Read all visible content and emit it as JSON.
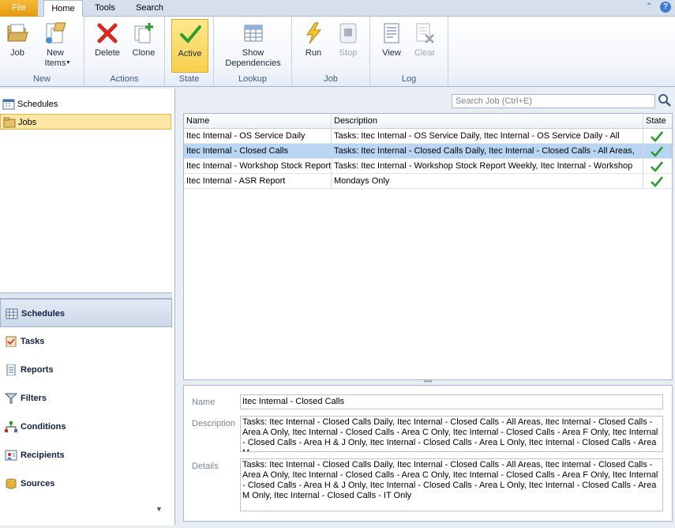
{
  "ribbon_tabs": {
    "file": "File",
    "home": "Home",
    "tools": "Tools",
    "search": "Search"
  },
  "window_controls": {
    "collapse": "⌃",
    "help": "?"
  },
  "ribbon": {
    "groups": {
      "new": "New",
      "actions": "Actions",
      "state": "State",
      "lookup": "Lookup",
      "job": "Job",
      "log": "Log"
    },
    "buttons": {
      "job": "Job",
      "new_items": "New Items",
      "delete": "Delete",
      "clone": "Clone",
      "active": "Active",
      "show_dependencies": "Show Dependencies",
      "run": "Run",
      "stop": "Stop",
      "view": "View",
      "clear": "Clear"
    }
  },
  "tree": {
    "schedules": "Schedules",
    "jobs": "Jobs"
  },
  "nav": [
    "Schedules",
    "Tasks",
    "Reports",
    "Filters",
    "Conditions",
    "Recipients",
    "Sources"
  ],
  "search": {
    "placeholder": "Search Job (Ctrl+E)"
  },
  "grid": {
    "headers": {
      "name": "Name",
      "description": "Description",
      "state": "State"
    },
    "rows": [
      {
        "name": "Itec Internal - OS Service Daily",
        "description": "Tasks: Itec Internal - OS Service Daily, Itec Internal - OS Service Daily - All",
        "state": "active"
      },
      {
        "name": "Itec Internal - Closed Calls",
        "description": "Tasks: Itec Internal - Closed Calls Daily, Itec Internal - Closed Calls - All Areas,",
        "state": "active"
      },
      {
        "name": "Itec Internal - Workshop Stock Report",
        "description": "Tasks: Itec Internal - Workshop Stock Report Weekly, Itec Internal - Workshop",
        "state": "active"
      },
      {
        "name": "Itec Internal - ASR Report",
        "description": "Mondays Only",
        "state": "active"
      }
    ]
  },
  "detail": {
    "labels": {
      "name": "Name",
      "description": "Description",
      "details": "Details"
    },
    "name": "Itec Internal - Closed Calls",
    "description": "Tasks: Itec Internal - Closed Calls Daily, Itec Internal - Closed Calls - All Areas, Itec Internal - Closed Calls - Area A Only, Itec Internal - Closed Calls - Area C Only, Itec Internal - Closed Calls - Area F Only, Itec Internal - Closed Calls - Area H & J Only, Itec Internal - Closed Calls - Area L Only, Itec Internal - Closed Calls - Area M",
    "details": "Tasks: Itec Internal - Closed Calls Daily, Itec Internal - Closed Calls - All Areas, Itec Internal - Closed Calls - Area A Only, Itec Internal - Closed Calls - Area C Only, Itec Internal - Closed Calls - Area F Only, Itec Internal - Closed Calls - Area H & J Only, Itec Internal - Closed Calls - Area L Only, Itec Internal - Closed Calls - Area M Only, Itec Internal - Closed Calls - IT Only"
  },
  "colors": {
    "selection": "#b8d6f4",
    "active_button": "#f8cf4e",
    "check": "#2f9a2f"
  }
}
